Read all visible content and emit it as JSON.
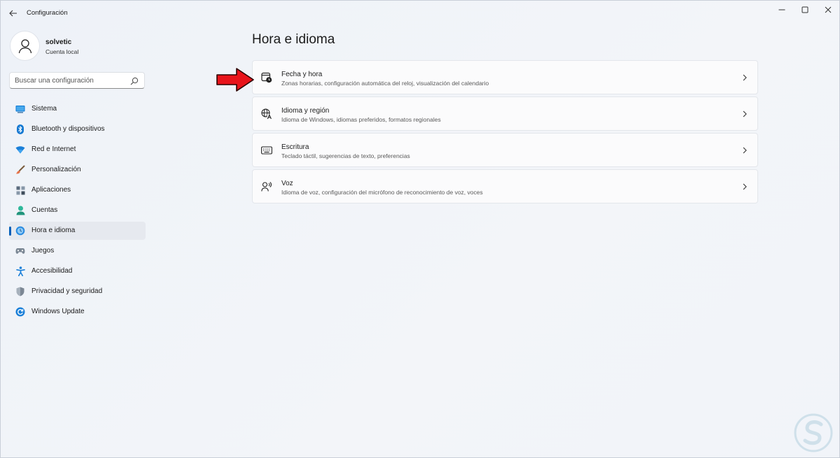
{
  "window": {
    "title": "Configuración"
  },
  "profile": {
    "name": "solvetic",
    "account_type": "Cuenta local"
  },
  "search": {
    "placeholder": "Buscar una configuración"
  },
  "sidebar": {
    "items": [
      {
        "label": "Sistema",
        "icon": "system-icon",
        "active": false
      },
      {
        "label": "Bluetooth y dispositivos",
        "icon": "bluetooth-icon",
        "active": false
      },
      {
        "label": "Red e Internet",
        "icon": "wifi-icon",
        "active": false
      },
      {
        "label": "Personalización",
        "icon": "brush-icon",
        "active": false
      },
      {
        "label": "Aplicaciones",
        "icon": "apps-icon",
        "active": false
      },
      {
        "label": "Cuentas",
        "icon": "account-icon",
        "active": false
      },
      {
        "label": "Hora e idioma",
        "icon": "globe-clock-icon",
        "active": true
      },
      {
        "label": "Juegos",
        "icon": "gamepad-icon",
        "active": false
      },
      {
        "label": "Accesibilidad",
        "icon": "accessibility-icon",
        "active": false
      },
      {
        "label": "Privacidad y seguridad",
        "icon": "shield-icon",
        "active": false
      },
      {
        "label": "Windows Update",
        "icon": "update-icon",
        "active": false
      }
    ]
  },
  "main": {
    "title": "Hora e idioma",
    "cards": [
      {
        "title": "Fecha y hora",
        "subtitle": "Zonas horarias, configuración automática del reloj, visualización del calendario",
        "icon": "calendar-clock-icon"
      },
      {
        "title": "Idioma y región",
        "subtitle": "Idioma de Windows, idiomas preferidos, formatos regionales",
        "icon": "language-icon"
      },
      {
        "title": "Escritura",
        "subtitle": "Teclado táctil, sugerencias de texto, preferencias",
        "icon": "keyboard-icon"
      },
      {
        "title": "Voz",
        "subtitle": "Idioma de voz, configuración del micrófono de reconocimiento de voz, voces",
        "icon": "speech-icon"
      }
    ]
  },
  "colors": {
    "accent": "#005fb8",
    "annotation_arrow": "#e8141b"
  }
}
